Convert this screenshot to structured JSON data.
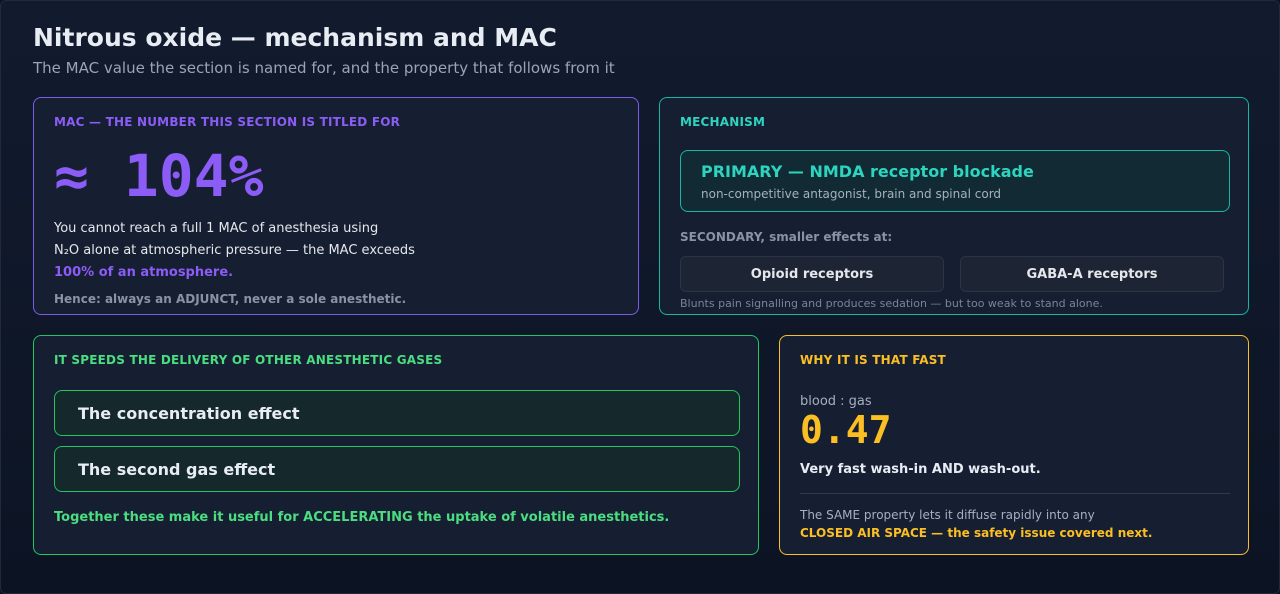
{
  "header": {
    "title": "Nitrous oxide — mechanism and MAC",
    "subtitle": "The MAC value the section is named for, and the property that follows from it"
  },
  "mac_card": {
    "label": "MAC — THE NUMBER THIS SECTION IS TITLED FOR",
    "value": "≈ 104%",
    "body_line1": "You cannot reach a full 1 MAC of anesthesia using",
    "body_line2": "N₂O alone at atmospheric pressure — the MAC exceeds",
    "body_accent": "100% of an atmosphere.",
    "note": "Hence: always an ADJUNCT, never a sole anesthetic."
  },
  "mechanism_card": {
    "label": "MECHANISM",
    "primary_title": "PRIMARY — NMDA receptor blockade",
    "primary_sub": "non-competitive antagonist, brain and spinal cord",
    "secondary_label": "SECONDARY, smaller effects at:",
    "receptors": [
      "Opioid receptors",
      "GABA-A receptors"
    ],
    "note": "Blunts pain signalling and produces sedation — but too weak to stand alone."
  },
  "speed_card": {
    "label": "IT SPEEDS THE DELIVERY OF OTHER ANESTHETIC GASES",
    "effects": [
      "The concentration effect",
      "The second gas effect"
    ],
    "note": "Together these make it useful for ACCELERATING the uptake of volatile anesthetics."
  },
  "why_card": {
    "label": "WHY IT IS THAT FAST",
    "ratio_label": "blood : gas",
    "ratio_value": "0.47",
    "washout": "Very fast wash-in AND wash-out.",
    "body_line1": "The SAME property lets it diffuse rapidly into any",
    "body_accent": "CLOSED AIR SPACE — the safety issue covered next."
  },
  "colors": {
    "background": "#0b1220",
    "mac_accent": "#8b5cf6",
    "mechanism_accent": "#2dd4bf",
    "speed_accent": "#4ade80",
    "why_accent": "#fbbf24"
  }
}
